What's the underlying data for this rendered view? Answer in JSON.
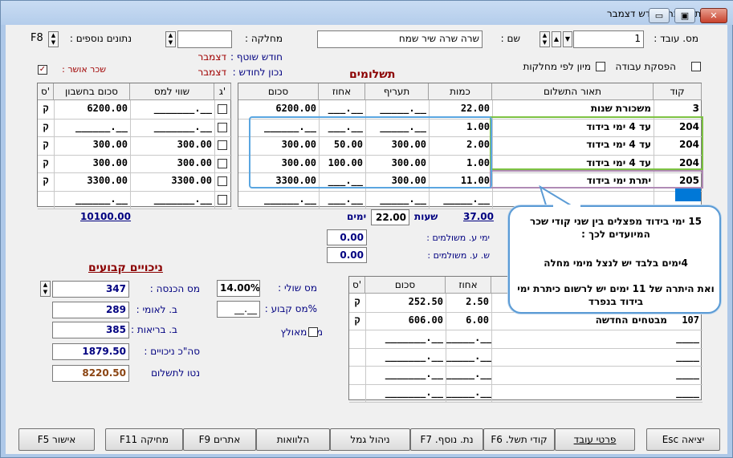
{
  "window": {
    "title": "הכנסת השכר לחודש דצמבר",
    "minimize": "▭",
    "maximize": "▣",
    "close": "✕"
  },
  "top": {
    "employee_no_label": "מס. עובד :",
    "employee_no": "1",
    "name_label": "שם :",
    "name_value": "שרה שרה שיר שמח",
    "dept_label": "מחלקה :",
    "dept_value": "",
    "extra_label": "נתונים נוספים :",
    "extra_key": "F8",
    "month_label1": "חודש שוטף :",
    "month_value1": "דצמבר",
    "month_label2": "נכון לחודש :",
    "month_value2": "דצמבר",
    "stop_work_label": "הפסקת עבודה",
    "sort_dept_label": "מיון לפי מחלקות",
    "approved_salary_label": "שכר אושר :"
  },
  "payments": {
    "title": "תשלומים",
    "headers": [
      "קוד",
      "תאור התשלום",
      "כמות",
      "תעריף",
      "אחוז",
      "סכום"
    ],
    "rows": [
      {
        "code": "3",
        "desc": "משכורת שנות",
        "qty": "22.00",
        "rate": "_____.__",
        "pct": "___.__",
        "amount": "6200.00"
      },
      {
        "code": "204",
        "desc": "עד 4 ימי בידוד",
        "qty": "1.00",
        "rate": "_____.__",
        "pct": "___.__",
        "amount": "______.__"
      },
      {
        "code": "204",
        "desc": "עד 4 ימי בידוד",
        "qty": "2.00",
        "rate": "300.00",
        "pct": "50.00",
        "amount": "300.00"
      },
      {
        "code": "204",
        "desc": "עד 4 ימי בידוד",
        "qty": "1.00",
        "rate": "300.00",
        "pct": "100.00",
        "amount": "300.00"
      },
      {
        "code": "205",
        "desc": "יתרת ימי בידוד",
        "qty": "11.00",
        "rate": "300.00",
        "pct": "___.__",
        "amount": "3300.00"
      },
      {
        "code": "",
        "desc": "",
        "qty": "_____.__",
        "rate": "_____.__",
        "pct": "___.__",
        "amount": "______.__"
      }
    ]
  },
  "right_grid": {
    "headers": [
      "ג'",
      "שווי למס",
      "סכום בחשבון",
      "ס'"
    ],
    "rows": [
      {
        "tax": "_______.__",
        "gross": "6200.00",
        "s": "ק"
      },
      {
        "tax": "_______.__",
        "gross": "______.__",
        "s": "ק"
      },
      {
        "tax": "300.00",
        "gross": "300.00",
        "s": "ק"
      },
      {
        "tax": "300.00",
        "gross": "300.00",
        "s": "ק"
      },
      {
        "tax": "3300.00",
        "gross": "3300.00",
        "s": "ק"
      },
      {
        "tax": "_______.__",
        "gross": "______.__",
        "s": ""
      }
    ],
    "total": "10100.00"
  },
  "summary": {
    "qty_total": "37.00",
    "hours_label": "שעות",
    "hours_value": "22.00",
    "days_label": "ימים",
    "paid_days_label": "ימי ע. משולמים :",
    "paid_days_value": "0.00",
    "paid_hours_label": "ש. ע. משולמים :",
    "paid_hours_value": "0.00"
  },
  "deductions": {
    "title": "ניכויים קבועים",
    "income_tax_label": "מס הכנסה :",
    "income_tax": "347",
    "national_ins_label": "ב. לאומי :",
    "national_ins": "289",
    "health_label": "ב. בריאות :",
    "health": "385",
    "total_label": "סה\"כ ניכויים :",
    "total": "1879.50",
    "net_label": "נטו לתשלום",
    "net": "8220.50",
    "marginal_label": "מס שולי :",
    "marginal": "14.00%",
    "fixed_label": "%מס קבוע :",
    "fixed": "__.__",
    "weighted_label": "מס מאולץ"
  },
  "ded_grid": {
    "headers": [
      "",
      "אחוז",
      "סכום",
      "ס'"
    ],
    "rows": [
      {
        "code": "",
        "desc": "",
        "pct": "2.50",
        "amt": "252.50",
        "s": "ק"
      },
      {
        "code": "107",
        "desc": "מבטחים החדשה",
        "pct": "6.00",
        "amt": "606.00",
        "s": "ק"
      },
      {
        "code": "____",
        "desc": "",
        "pct": "_____.__",
        "amt": "_______.__",
        "s": ""
      },
      {
        "code": "____",
        "desc": "",
        "pct": "_____.__",
        "amt": "_______.__",
        "s": ""
      },
      {
        "code": "____",
        "desc": "",
        "pct": "_____.__",
        "amt": "_______.__",
        "s": ""
      },
      {
        "code": "____",
        "desc": "",
        "pct": "_____.__",
        "amt": "_______.__",
        "s": ""
      }
    ]
  },
  "callout": {
    "line1": "15 ימי בידוד מפצלים בין שני קודי  שכר המיועדים לכך :",
    "line2": "4ימים בלבד יש לנצל מימי מחלה",
    "line3": "ואת היתרה של 11 ימים יש לרשום כיתרת ימי בידוד בנפרד"
  },
  "buttons": {
    "exit": "יציאה Esc",
    "details": "פרטי עובד",
    "codes": "קודי תשל. F6",
    "extra_data": "נת. נוסף. F7",
    "provident": "ניהול גמל",
    "loans": "הלוואות",
    "alerts": "אתרים F9",
    "delete": "מחיקה F11",
    "approve": "אישור F5"
  },
  "colors": {
    "highlight_green": "#7dc242",
    "highlight_purple": "#b08bb5",
    "highlight_blue": "#5aa6e0",
    "accent": "#0078d7"
  }
}
